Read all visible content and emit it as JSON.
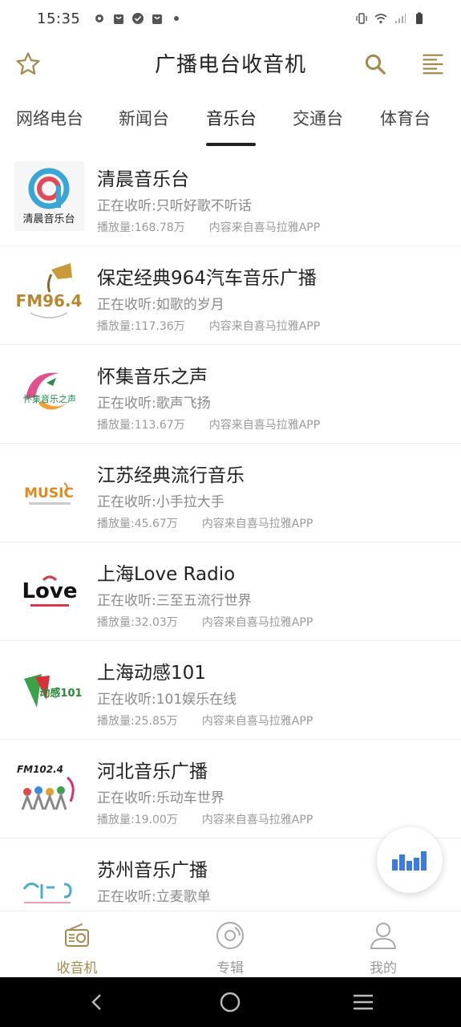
{
  "status_bar": {
    "time": "15:35"
  },
  "header": {
    "title": "广播电台收音机",
    "icons": [
      "star-icon",
      "search-icon",
      "menu-icon"
    ]
  },
  "tabs": [
    {
      "label": "网络电台"
    },
    {
      "label": "新闻台"
    },
    {
      "label": "音乐台"
    },
    {
      "label": "交通台"
    },
    {
      "label": "体育台"
    }
  ],
  "active_tab": "音乐台",
  "stations": [
    {
      "name": "清晨音乐台",
      "playing": "正在收听:只听好歌不听话",
      "plays": "播放量:168.78万",
      "source": "内容来自喜马拉雅APP",
      "logo_text": "清晨音乐台"
    },
    {
      "name": "保定经典964汽车音乐广播",
      "playing": "正在收听:如歌的岁月",
      "plays": "播放量:117.36万",
      "source": "内容来自喜马拉雅APP",
      "logo_text": "FM96.4"
    },
    {
      "name": "怀集音乐之声",
      "playing": "正在收听:歌声飞扬",
      "plays": "播放量:113.67万",
      "source": "内容来自喜马拉雅APP",
      "logo_text": "怀集音乐之声"
    },
    {
      "name": "江苏经典流行音乐",
      "playing": "正在收听:小手拉大手",
      "plays": "播放量:45.67万",
      "source": "内容来自喜马拉雅APP",
      "logo_text": "MUSIC"
    },
    {
      "name": "上海Love Radio",
      "playing": "正在收听:三至五流行世界",
      "plays": "播放量:32.03万",
      "source": "内容来自喜马拉雅APP",
      "logo_text": "Love"
    },
    {
      "name": "上海动感101",
      "playing": "正在收听:101娱乐在线",
      "plays": "播放量:25.85万",
      "source": "内容来自喜马拉雅APP",
      "logo_text": "动感101"
    },
    {
      "name": "河北音乐广播",
      "playing": "正在收听:乐动车世界",
      "plays": "播放量:19.00万",
      "source": "内容来自喜马拉雅APP",
      "logo_text": "FM102.4"
    },
    {
      "name": "苏州音乐广播",
      "playing": "正在收听:立麦歌单",
      "plays": "",
      "source": "",
      "logo_text": ""
    }
  ],
  "bottom_nav": [
    {
      "label": "收音机",
      "icon": "radio-icon",
      "active": true
    },
    {
      "label": "专辑",
      "icon": "disc-icon",
      "active": false
    },
    {
      "label": "我的",
      "icon": "user-icon",
      "active": false
    }
  ],
  "colors": {
    "accent": "#a68a4b",
    "fab_bars": "#3b7be3"
  }
}
